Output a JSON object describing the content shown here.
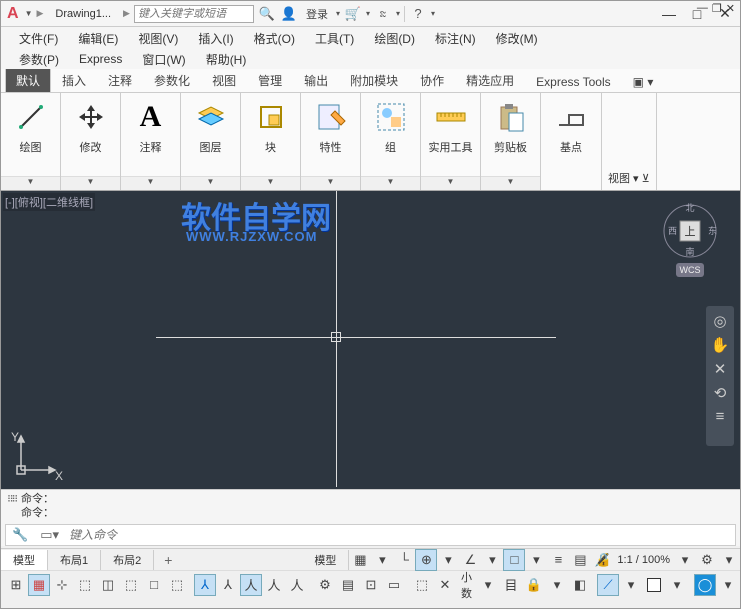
{
  "title": {
    "doc_name": "Drawing1...",
    "search_placeholder": "键入关键字或短语",
    "login": "登录"
  },
  "menu": {
    "file": "文件(F)",
    "edit": "编辑(E)",
    "view": "视图(V)",
    "insert": "插入(I)",
    "format": "格式(O)",
    "tools": "工具(T)",
    "draw": "绘图(D)",
    "dim": "标注(N)",
    "modify": "修改(M)",
    "param": "参数(P)",
    "express": "Express",
    "window": "窗口(W)",
    "help": "帮助(H)"
  },
  "ribbon_tabs": {
    "default": "默认",
    "insert": "插入",
    "annotate": "注释",
    "param": "参数化",
    "view": "视图",
    "manage": "管理",
    "output": "输出",
    "addons": "附加模块",
    "collab": "协作",
    "featured": "精选应用",
    "express": "Express Tools"
  },
  "ribbon": {
    "draw": "绘图",
    "modify": "修改",
    "annotate": "注释",
    "layers": "图层",
    "block": "块",
    "props": "特性",
    "group": "组",
    "utils": "实用工具",
    "clipboard": "剪贴板",
    "base": "基点",
    "view_label": "视图 ▾ ⊻"
  },
  "watermark": {
    "main": "软件自学网",
    "sub": "WWW.RJZXW.COM"
  },
  "canvas": {
    "viewport_label": "[-][俯视][二维线框]",
    "wcs": "WCS",
    "top_face": "上"
  },
  "cmd": {
    "hist1": "命令：",
    "hist2": "命令：",
    "placeholder": "键入命令"
  },
  "layout": {
    "model": "模型",
    "l1": "布局1",
    "l2": "布局2",
    "model_r": "模型"
  },
  "status": {
    "scale": "1:1 / 100%",
    "decimal": "小数",
    "annoscale_icon": "⤢"
  }
}
